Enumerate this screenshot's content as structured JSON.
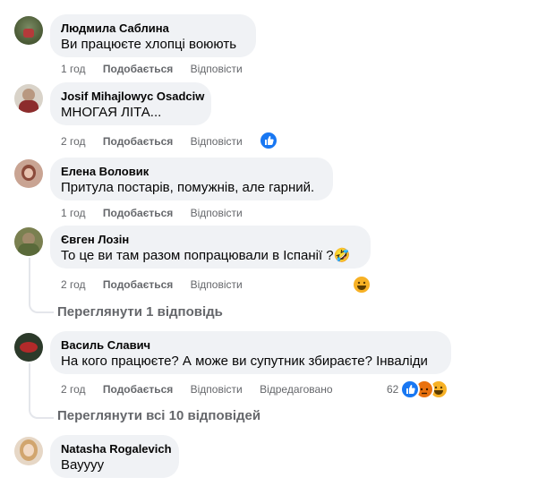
{
  "comments": [
    {
      "author": "Людмила Саблина",
      "text": "Ви працюєте хлопці воюють",
      "time": "1 год",
      "like": "Подобається",
      "reply": "Відповісти"
    },
    {
      "author": "Josif Mihajlowyc Osadciw",
      "text": "МНОГАЯ ЛІТА...",
      "time": "2 год",
      "like": "Подобається",
      "reply": "Відповісти",
      "reaction": "like-reaction-icon"
    },
    {
      "author": "Елена Воловик",
      "text": "Притула постарів, помужнів, але гарний.",
      "time": "1 год",
      "like": "Подобається",
      "reply": "Відповісти"
    },
    {
      "author": "Євген Лозін",
      "text": "То це ви там разом попрацювали в Іспанії ?🤣",
      "time": "2 год",
      "like": "Подобається",
      "reply": "Відповісти",
      "reaction": "haha-reaction-icon",
      "replies": "Переглянути 1 відповідь"
    },
    {
      "author": "Василь Славич",
      "text": "На кого працюєте? А може ви супутник збираєте? Інваліди",
      "time": "2 год",
      "like": "Подобається",
      "reply": "Відповісти",
      "edited": "Відредаговано",
      "reaction_count": "62",
      "replies": "Переглянути всі 10 відповідей"
    },
    {
      "author": "Natasha Rogalevich",
      "text": "Вауууу",
      "time": "",
      "like": "",
      "reply": ""
    }
  ],
  "colors": {
    "bubble": "#f0f2f5",
    "meta": "#65676b",
    "like": "#1877f2",
    "haha": "#f7b125",
    "angry": "#e9710f"
  }
}
